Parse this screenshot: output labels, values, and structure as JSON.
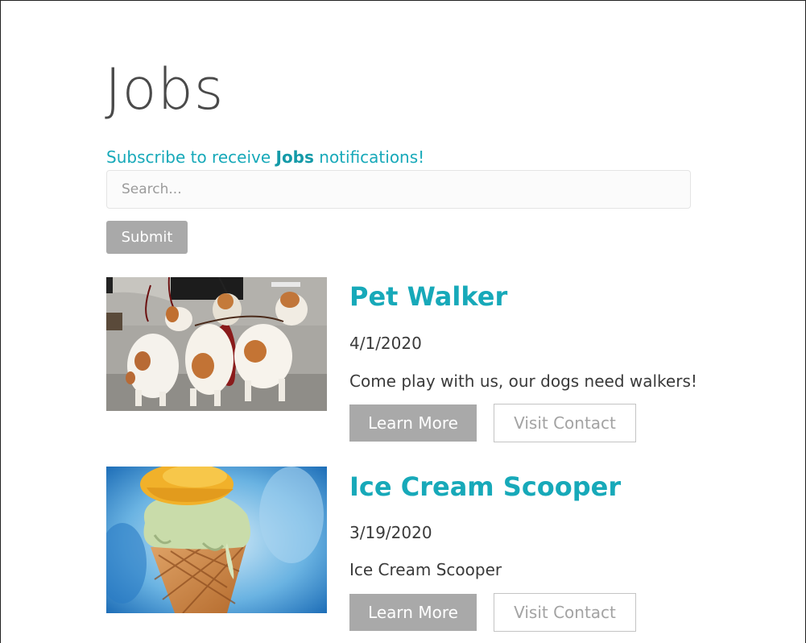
{
  "page": {
    "title": "Jobs"
  },
  "subscribe": {
    "prefix": "Subscribe to receive ",
    "emphasis": "Jobs",
    "suffix": " notifications!",
    "color": "#17a9b9"
  },
  "search": {
    "placeholder": "Search...",
    "value": ""
  },
  "form": {
    "submit_label": "Submit"
  },
  "jobs": [
    {
      "title": "Pet Walker",
      "date": "4/1/2020",
      "description": "Come play with us, our dogs need walkers!",
      "image": "dogs-on-leashes-photo",
      "learn_more_label": "Learn More",
      "contact_label": "Visit Contact"
    },
    {
      "title": "Ice Cream Scooper",
      "date": "3/19/2020",
      "description": "Ice Cream Scooper",
      "image": "ice-cream-cone-photo",
      "learn_more_label": "Learn More",
      "contact_label": "Visit Contact"
    }
  ],
  "colors": {
    "accent": "#17a9b9",
    "button_gray": "#a9a9a9",
    "text": "#3a3a3a"
  }
}
